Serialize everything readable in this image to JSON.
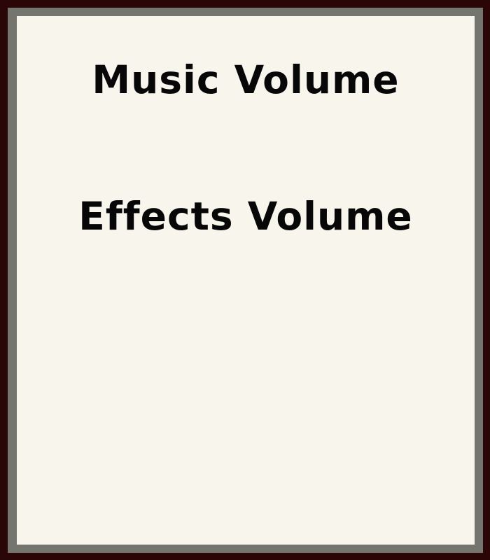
{
  "settings_panel": {
    "music_volume_label": "Music Volume",
    "effects_volume_label": "Effects Volume"
  },
  "colors": {
    "outer_frame": "#2a0606",
    "inner_frame": "#74756f",
    "panel_background": "#f7f5ec",
    "text": "#070707"
  }
}
